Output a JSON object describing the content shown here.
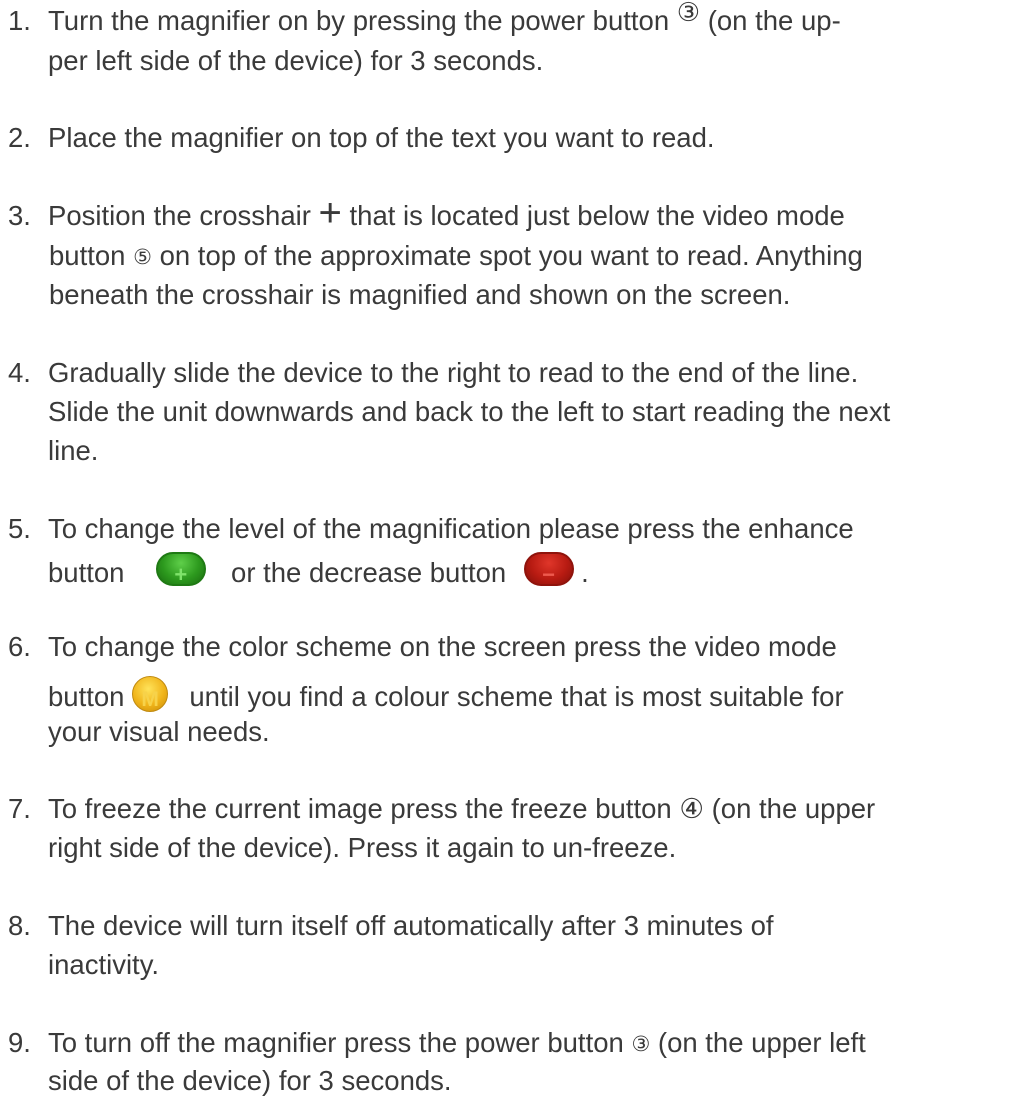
{
  "steps": [
    {
      "num": "1.",
      "l1a": "Turn the magnifier on by pressing the power button ",
      "l1sym": "③",
      "l1b": "  (on the up-",
      "l2": "per left side of the device) for 3 seconds."
    },
    {
      "num": "2.",
      "l1": "Place the magnifier on top of the text you want to read."
    },
    {
      "num": "3.",
      "l1a": "Position the crosshair ",
      "l1sym": "+",
      "l1b": " that is located just below the video mode",
      "l2a": "button ",
      "l2sym": "⑤",
      "l2b": " on top of the approximate spot you want to read. Anything",
      "l3": "beneath the crosshair is magnified and shown on the screen."
    },
    {
      "num": "4.",
      "l1": "Gradually slide the device to the right to read to the end of the line.",
      "l2": "Slide the unit downwards and back to the left to start reading the next",
      "l3": "line."
    },
    {
      "num": "5.",
      "l1": "To change the level of the magnification please press the enhance",
      "l2a": "button",
      "l2mid": "or the decrease button",
      "l2end": ".",
      "plus_glyph": "+",
      "minus_glyph": "−"
    },
    {
      "num": "6.",
      "l1": "To change the color scheme on the screen press the video mode",
      "l2a": "button",
      "l2b": "until you find a colour scheme that is most suitable for",
      "l3": "your visual needs.",
      "m_glyph": "M"
    },
    {
      "num": "7.",
      "l1a": "To freeze the current image press the freeze button ",
      "l1sym": "④",
      "l1b": " (on the upper",
      "l2": "right side of the device). Press it again to un-freeze."
    },
    {
      "num": "8.",
      "l1": "The device will turn itself off automatically after 3 minutes of",
      "l2": "inactivity."
    },
    {
      "num": "9.",
      "l1a": "To turn off the magnifier press the power button ",
      "l1sym": "③",
      "l1b": "  (on the upper left",
      "l2": "side of the device) for  3 seconds."
    }
  ],
  "colors": {
    "text": "#3a3a3a",
    "enhance_button": "#2d9a1e",
    "decrease_button": "#b81b12",
    "video_mode_button": "#f0b41a"
  }
}
